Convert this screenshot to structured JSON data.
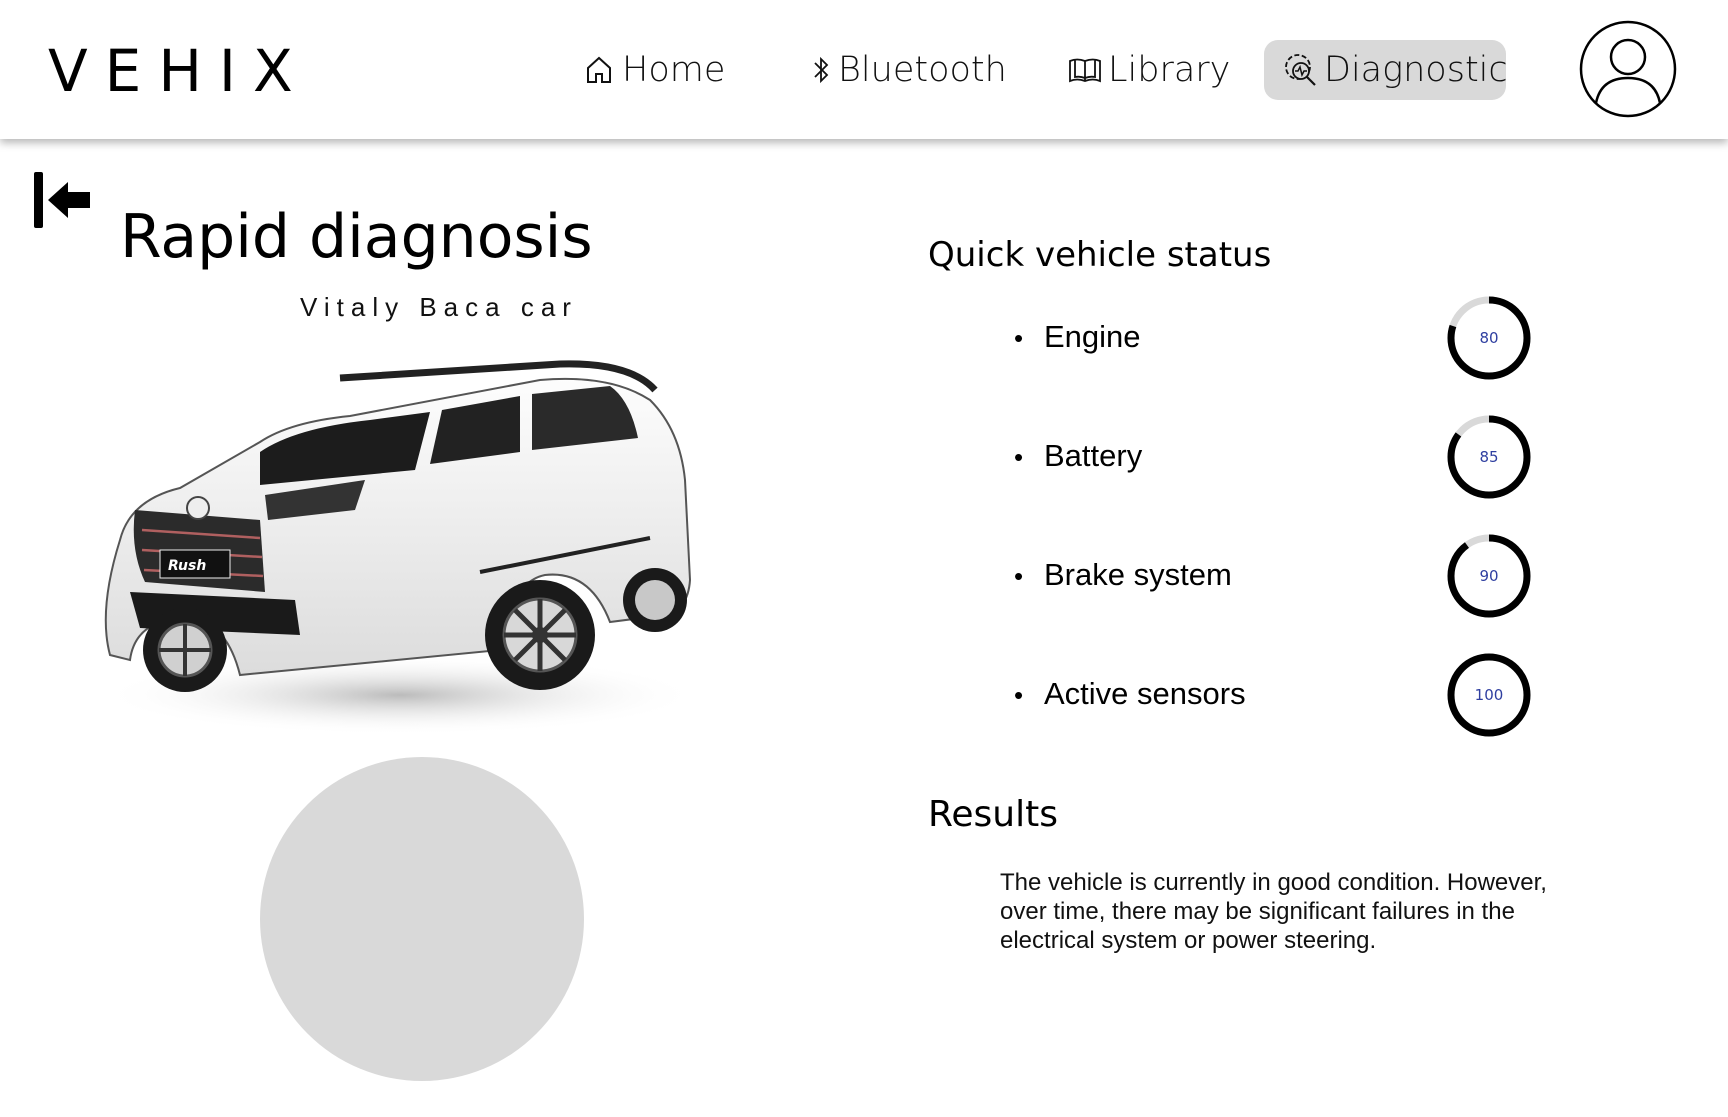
{
  "header": {
    "logo": "VEHIX",
    "nav": [
      {
        "label": "Home",
        "icon": "home-icon"
      },
      {
        "label": "Bluetooth",
        "icon": "bluetooth-icon"
      },
      {
        "label": "Library",
        "icon": "book-icon"
      },
      {
        "label": "Diagnostic",
        "icon": "diagnostic-icon",
        "active": true
      }
    ],
    "avatar_icon": "user-avatar-icon"
  },
  "main": {
    "title": "Rapid diagnosis",
    "subtitle": "Vitaly Baca car",
    "back_icon": "arrow-left-to-bar-icon",
    "car_image": "white-suv-image"
  },
  "status": {
    "title": "Quick vehicle status",
    "items": [
      {
        "label": "Engine",
        "value": 80
      },
      {
        "label": "Battery",
        "value": 85
      },
      {
        "label": "Brake system",
        "value": 90
      },
      {
        "label": "Active sensors",
        "value": 100
      }
    ]
  },
  "results": {
    "title": "Results",
    "text": "The vehicle is currently in good condition. However, over time, there may be significant failures in the electrical system or power steering."
  },
  "colors": {
    "active_nav_bg": "#d9d9d9",
    "gauge_track": "#d9d9d9",
    "gauge_fill": "#000000",
    "gauge_value_text": "#2f3fa0",
    "placeholder": "#d9d9d9"
  }
}
